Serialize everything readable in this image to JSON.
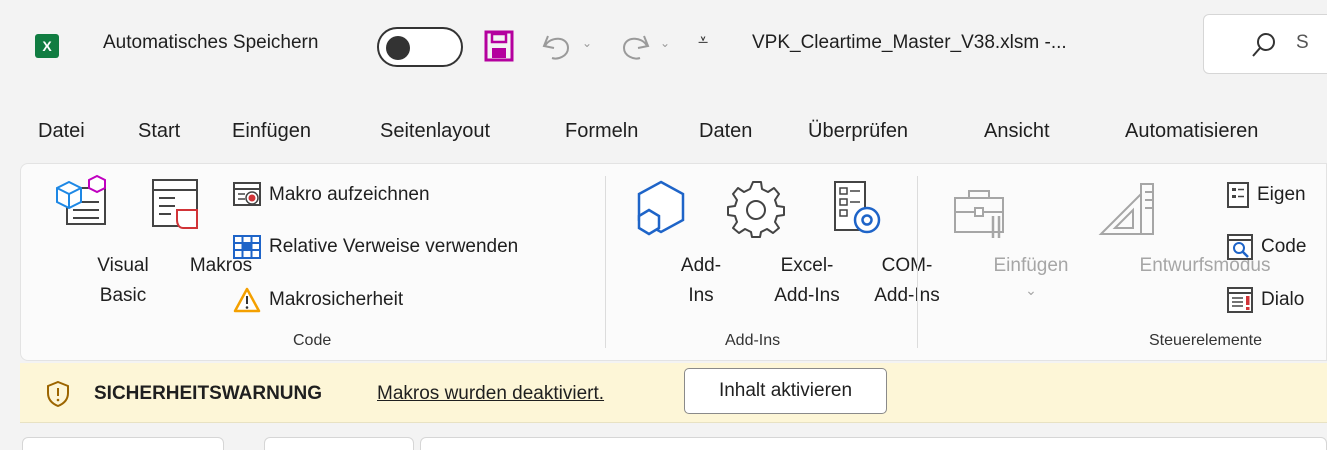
{
  "titlebar": {
    "app_icon_letter": "X",
    "autosave_label": "Automatisches Speichern",
    "autosave_on": false,
    "filename": "VPK_Cleartime_Master_V38.xlsm  -...",
    "search_text": "S"
  },
  "tabs": [
    "Datei",
    "Start",
    "Einfügen",
    "Seitenlayout",
    "Formeln",
    "Daten",
    "Überprüfen",
    "Ansicht",
    "Automatisieren"
  ],
  "ribbon": {
    "code": {
      "label": "Code",
      "visual_basic_line1": "Visual",
      "visual_basic_line2": "Basic",
      "makros": "Makros",
      "record_macro": "Makro aufzeichnen",
      "relative_refs": "Relative Verweise verwenden",
      "macro_security": "Makrosicherheit"
    },
    "addins": {
      "label": "Add-Ins",
      "addins_line1": "Add-",
      "addins_line2": "Ins",
      "excel_addins_line1": "Excel-",
      "excel_addins_line2": "Add-Ins",
      "com_addins_line1": "COM-",
      "com_addins_line2": "Add-Ins"
    },
    "controls": {
      "label": "Steuerelemente",
      "insert": "Einfügen",
      "insert_drop": "⌄",
      "design_mode": "Entwurfsmodus",
      "properties": "Eigen",
      "view_code": "Code",
      "dialog": "Dialo"
    }
  },
  "security": {
    "title": "SICHERHEITSWARNUNG",
    "message": "Makros wurden deaktiviert.",
    "button": "Inhalt aktivieren"
  },
  "colors": {
    "excel_green": "#107c41",
    "save_purple": "#b4009e",
    "warning_bg": "#fdf6d7",
    "macro_security_orange": "#f4a000"
  }
}
